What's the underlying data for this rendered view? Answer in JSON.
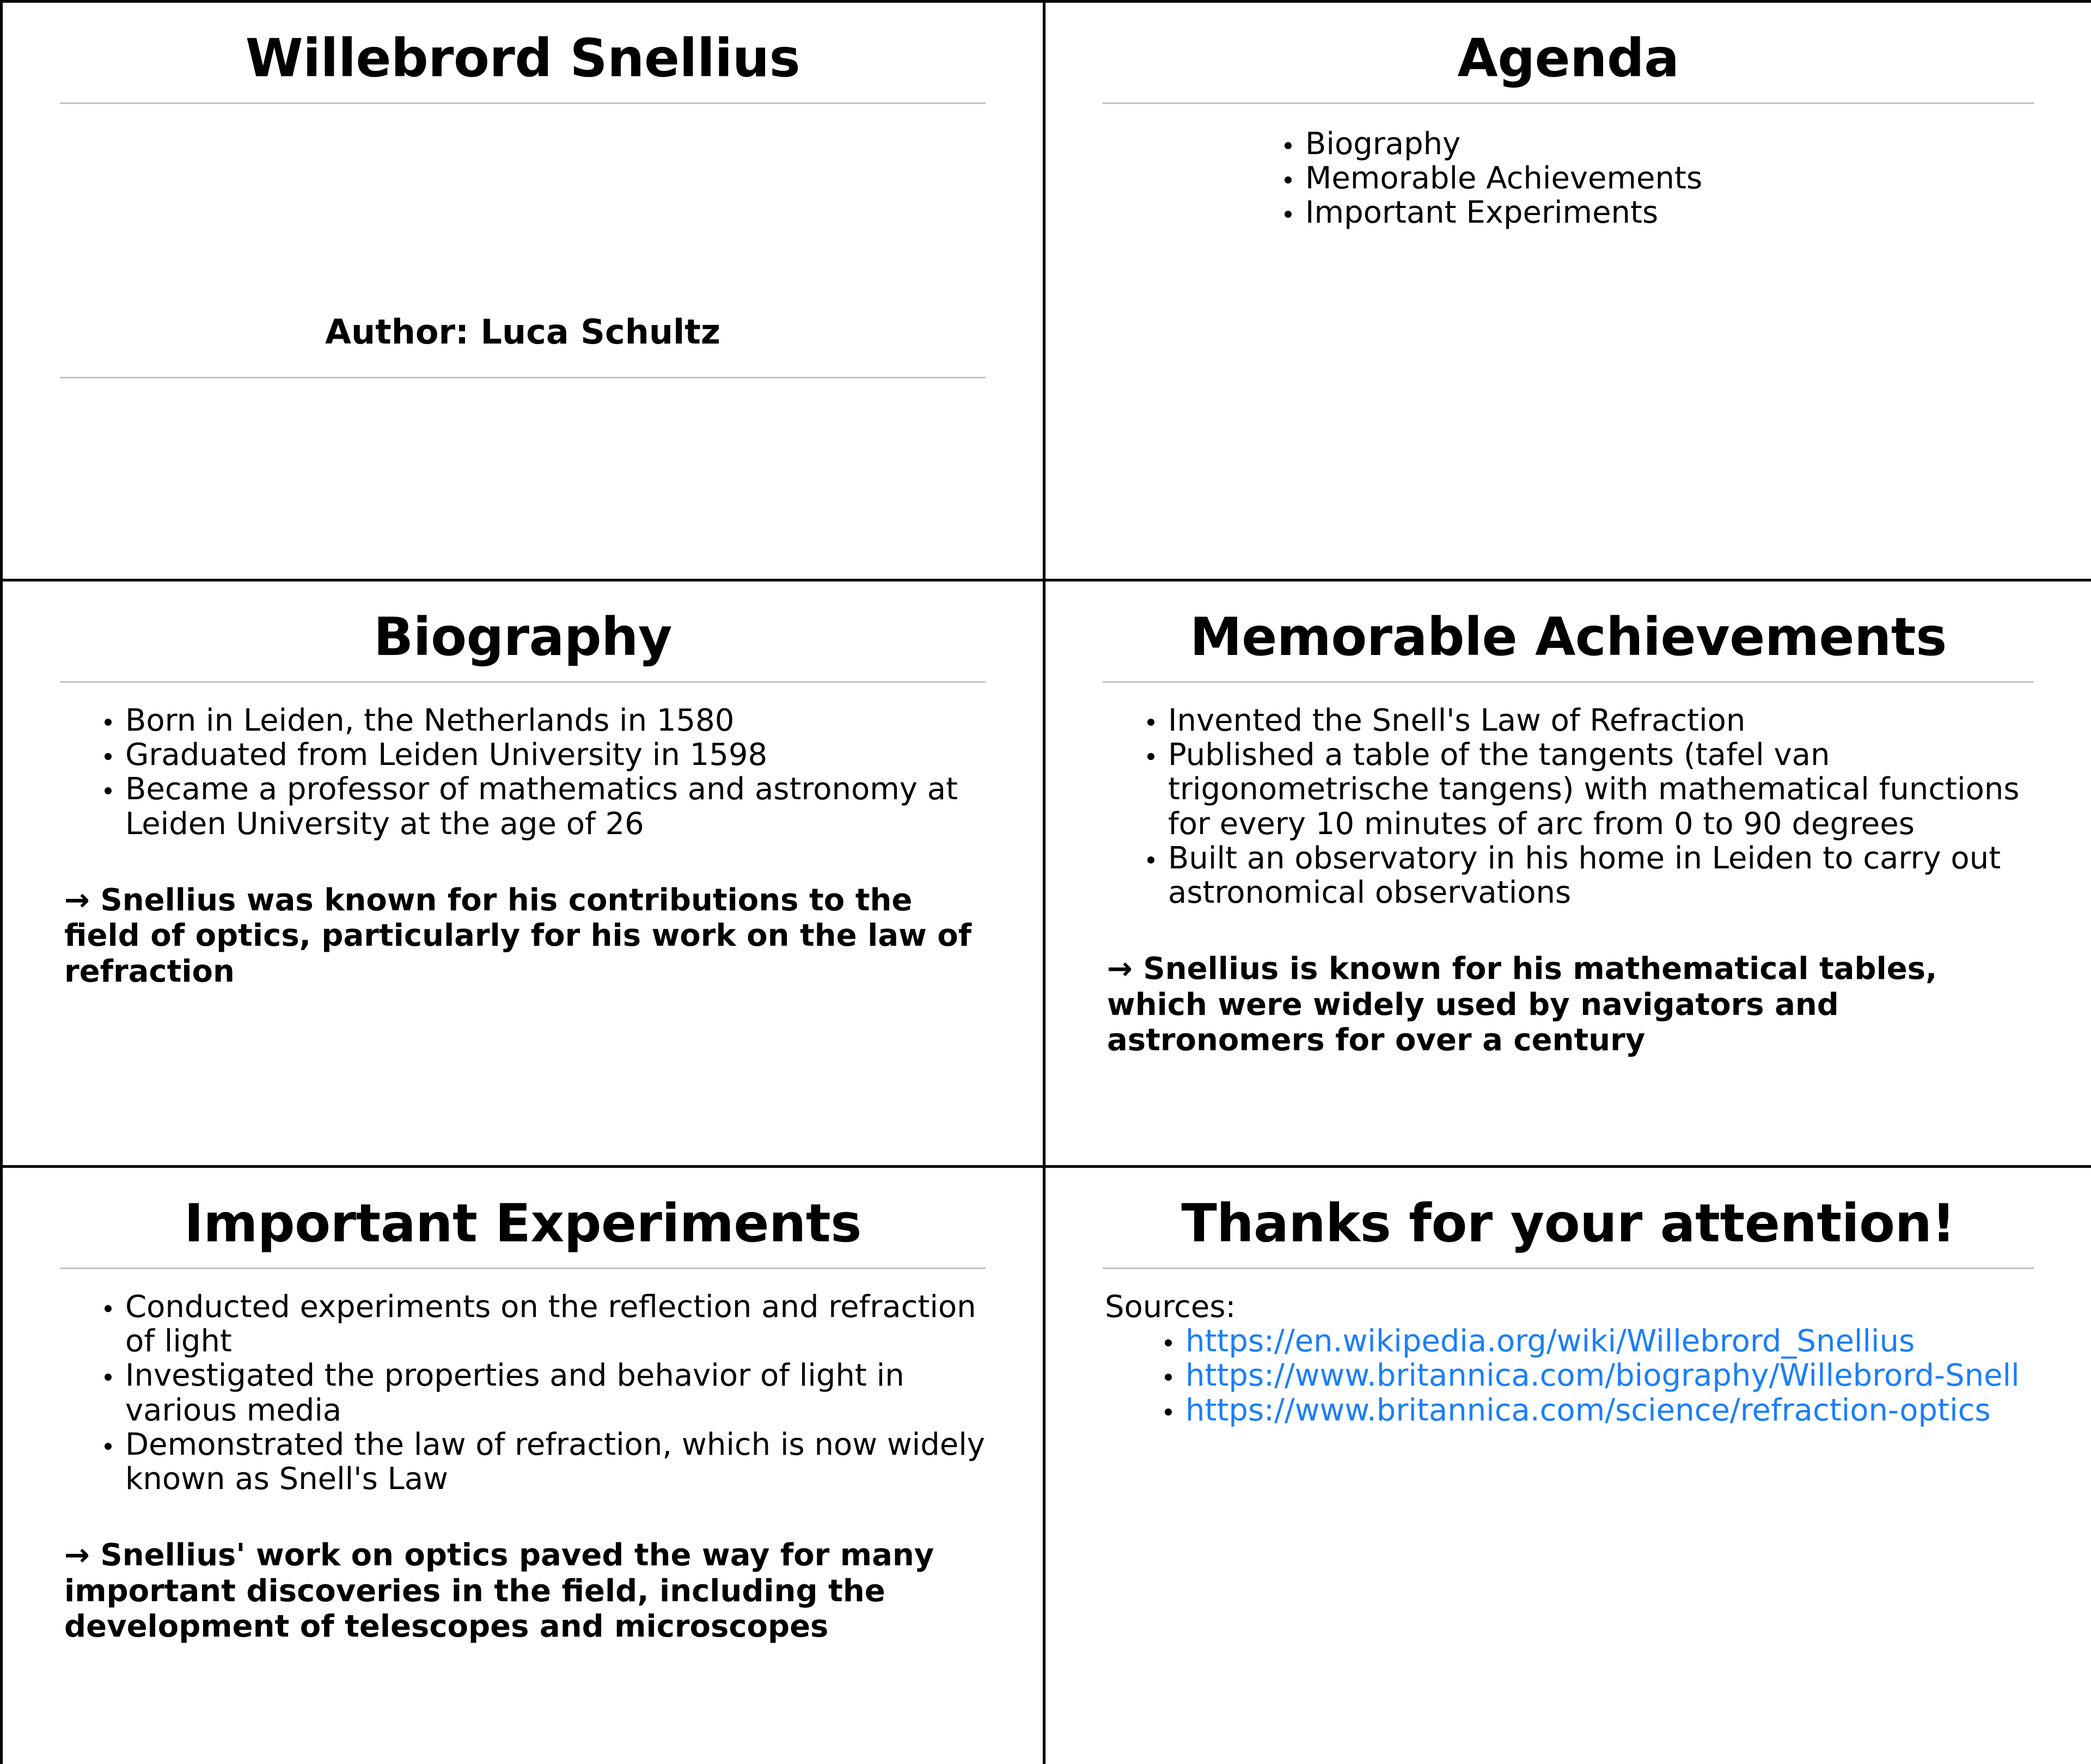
{
  "theme": {
    "background": "#ffffff",
    "text_color": "#000000",
    "panel_border_color": "#000000",
    "rule_color": "#c3c3c3",
    "link_color": "#1a7efb",
    "bullet_color": "#000000"
  },
  "slides": [
    {
      "id": "title-slide",
      "title": "Willebrord Snellius",
      "author": "Author: Luca Schultz"
    },
    {
      "id": "agenda-slide",
      "title": "Agenda",
      "items": [
        "Biography",
        "Memorable Achievements",
        "Important Experiments"
      ]
    },
    {
      "id": "biography-slide",
      "title": "Biography",
      "bullets": [
        "Born in Leiden, the Netherlands in 1580",
        "Graduated from Leiden University in 1598",
        "Became a professor of mathematics and astronomy at Leiden University at the age of 26"
      ],
      "takeaway_arrow": "→",
      "takeaway": "Snellius was known for his contributions to the field of optics, particularly for his work on the law of refraction"
    },
    {
      "id": "achievements-slide",
      "title": "Memorable Achievements",
      "bullets": [
        "Invented the Snell's Law of Refraction",
        "Published a table of the tangents (tafel van trigonometrische tangens) with mathematical functions for every 10 minutes of arc from 0 to 90 degrees",
        "Built an observatory in his home in Leiden to carry out astronomical observations"
      ],
      "takeaway_arrow": "→",
      "takeaway": "Snellius is known for his mathematical tables, which were widely used by navigators and astronomers for over a century"
    },
    {
      "id": "experiments-slide",
      "title": "Important Experiments",
      "bullets": [
        "Conducted experiments on the reflection and refraction of light",
        "Investigated the properties and behavior of light in various media",
        "Demonstrated the law of refraction, which is now widely known as Snell's Law"
      ],
      "takeaway_arrow": "→",
      "takeaway": "Snellius' work on optics paved the way for many important discoveries in the field, including the development of telescopes and microscopes"
    },
    {
      "id": "thanks-slide",
      "title": "Thanks for your attention!",
      "sources_label": "Sources:",
      "sources": [
        "https://en.wikipedia.org/wiki/Willebrord_Snellius",
        "https://www.britannica.com/biography/Willebrord-Snell",
        "https://www.britannica.com/science/refraction-optics"
      ]
    }
  ]
}
